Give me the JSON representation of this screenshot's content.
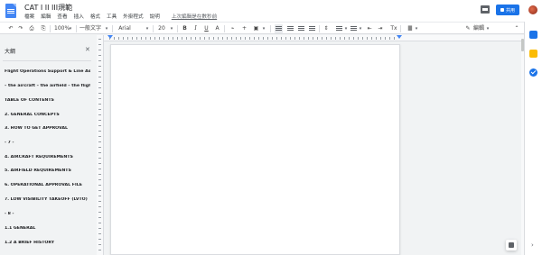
{
  "document": {
    "title": "CAT I II III規範",
    "star": "☆",
    "last_edit": "上次編輯是在數秒前"
  },
  "menu": [
    "檔案",
    "編輯",
    "查看",
    "插入",
    "格式",
    "工具",
    "外掛程式",
    "說明"
  ],
  "share": {
    "label": "共用"
  },
  "toolbar": {
    "undo": "↶",
    "redo": "↷",
    "print": "⎙",
    "paint_format": "⎘",
    "zoom": "100%",
    "style": "一般文字",
    "font": "Arial",
    "font_size": "20",
    "bold": "B",
    "italic": "I",
    "underline": "U",
    "text_color": "A",
    "link": "⌁",
    "comment": "+",
    "image": "▣",
    "line_spacing": "⇕",
    "more": "⋮",
    "mode": "編輯",
    "drop": "▾",
    "pen": "✎",
    "collapse": "⌃",
    "clear": "Tx",
    "indent": "⇥",
    "outdent": "⇤"
  },
  "outline": {
    "header": "大綱",
    "close": "✕",
    "items": [
      "Flight Operations Support & Line Assista...",
      "– the aircraft – the airfield – the flight cre...",
      "TABLE OF CONTENTS",
      "2. GENERAL CONCEPTS",
      "3. HOW TO GET APPROVAL",
      "- 7 -",
      "4. AIRCRAFT REQUIREMENTS",
      "5. AIRFIELD REQUIREMENTS",
      "6. OPERATIONAL APPROVAL FILE",
      "7. LOW VISIBILITY TAKEOFF (LVTO)",
      "- 8 -",
      "1.1 GENERAL",
      "1.2 A BRIEF HISTORY"
    ]
  },
  "side_panel": {
    "chevron": "›"
  },
  "colors": {
    "accent": "#1a73e8",
    "page_bg": "#f1f3f4"
  }
}
